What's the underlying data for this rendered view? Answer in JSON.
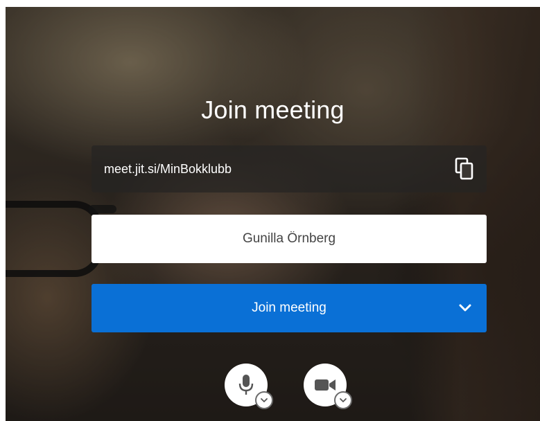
{
  "prejoin": {
    "title": "Join meeting",
    "meeting_url": "meet.jit.si/MinBokklubb",
    "copy_icon": "copy-icon",
    "name_input": {
      "value": "Gunilla Örnberg",
      "placeholder": ""
    },
    "join_button": {
      "label": "Join meeting",
      "dropdown_icon": "chevron-down-icon"
    },
    "media_controls": {
      "microphone_icon": "microphone-icon",
      "camera_icon": "video-camera-icon",
      "options_icon": "chevron-down-icon"
    }
  },
  "colors": {
    "accent": "#0a70d6",
    "text_on_dark": "#ffffff",
    "input_text": "#444444"
  }
}
